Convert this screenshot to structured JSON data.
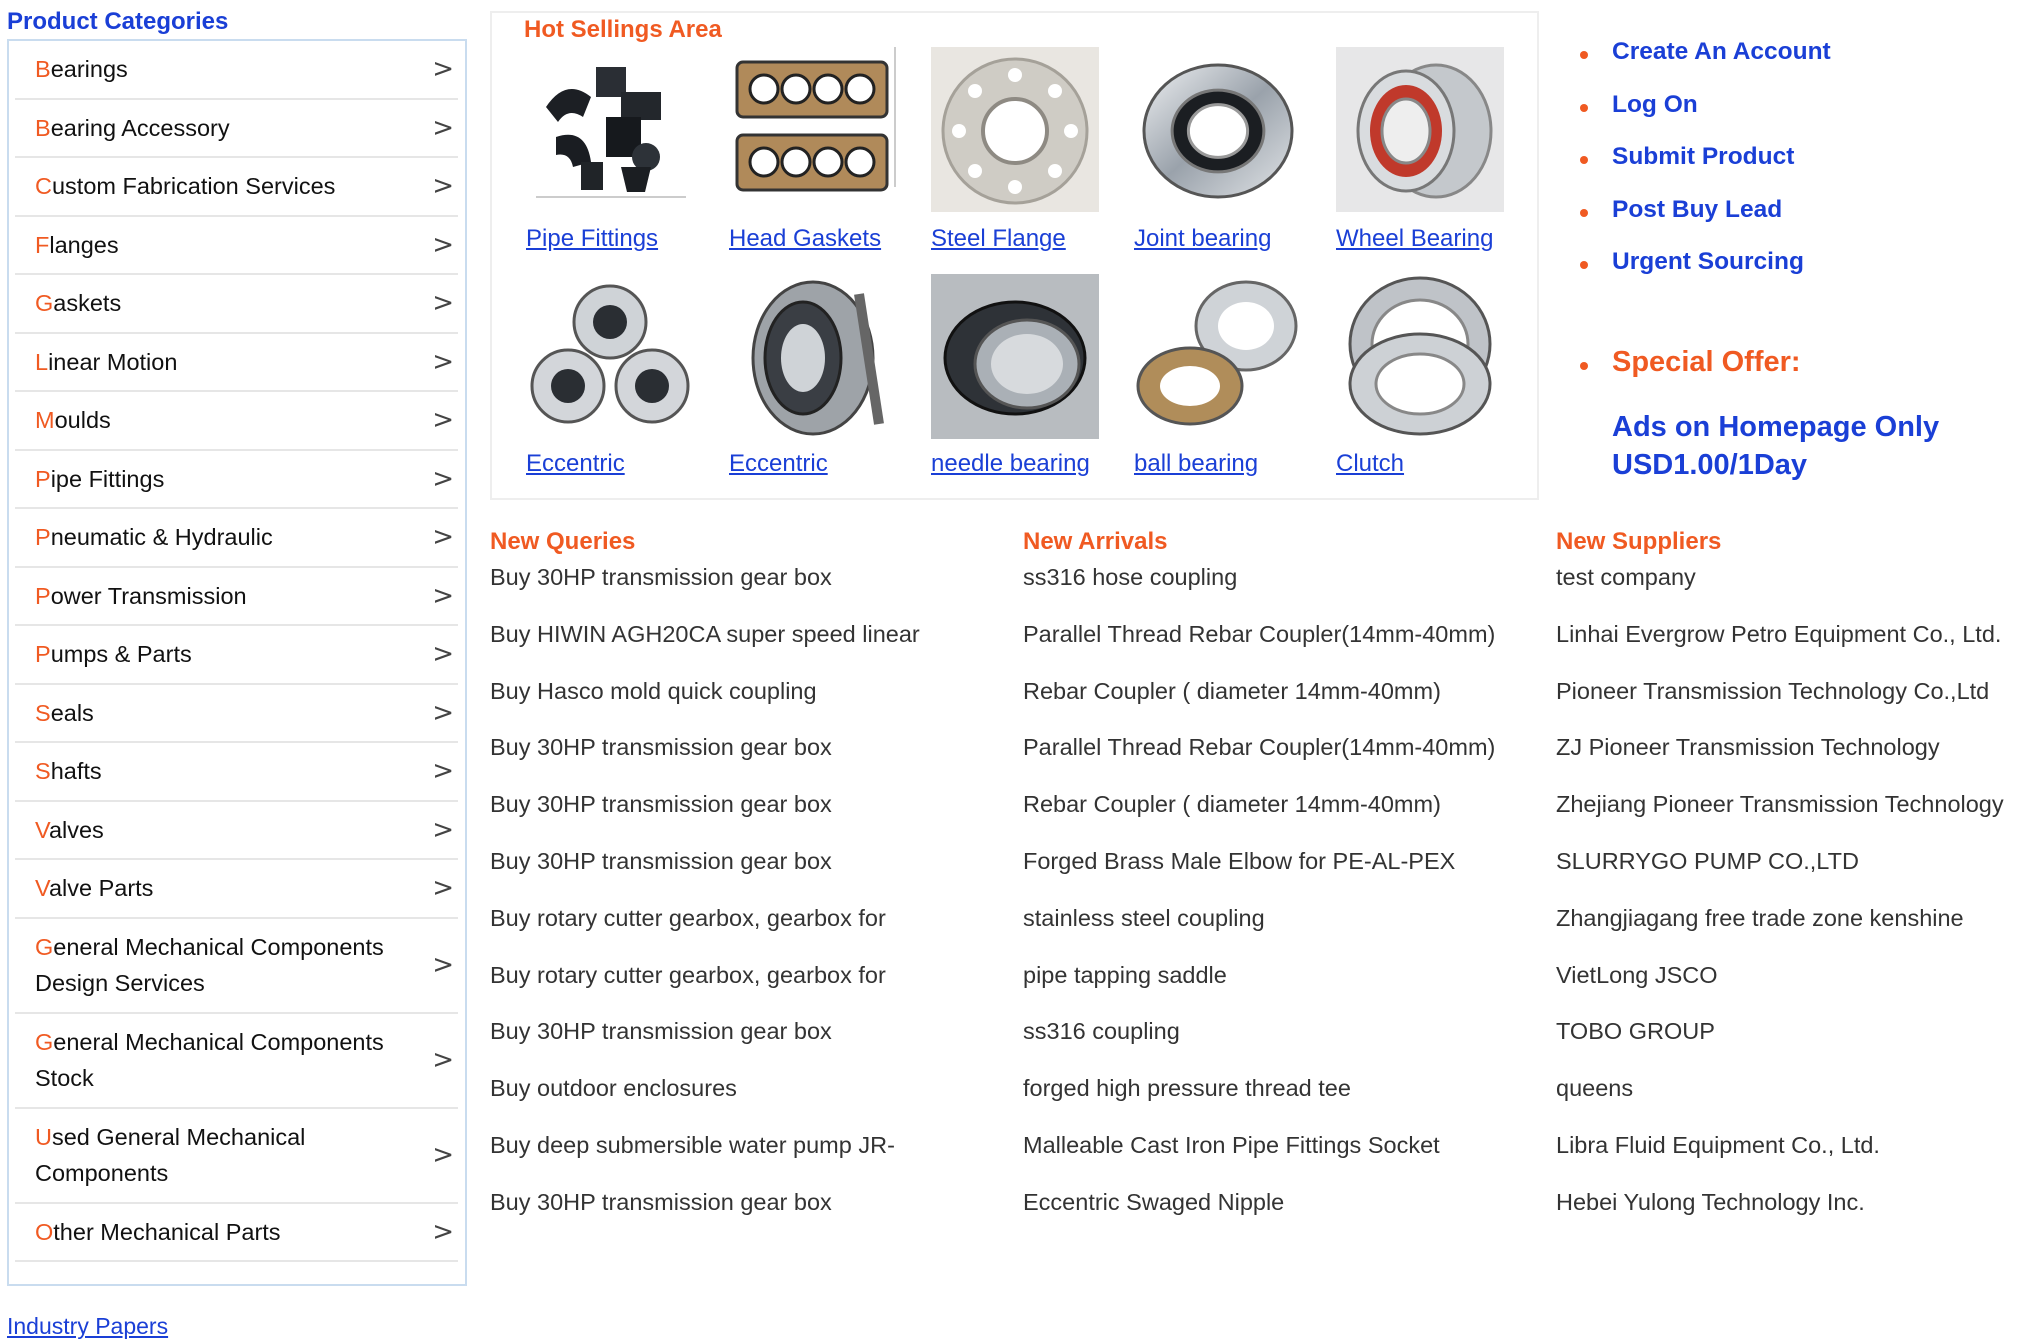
{
  "sidebar": {
    "title": "Product Categories",
    "items": [
      {
        "first": "B",
        "rest": "earings"
      },
      {
        "first": "B",
        "rest": "earing Accessory"
      },
      {
        "first": "C",
        "rest": "ustom Fabrication Services"
      },
      {
        "first": "F",
        "rest": "langes"
      },
      {
        "first": "G",
        "rest": "askets"
      },
      {
        "first": "L",
        "rest": "inear Motion"
      },
      {
        "first": "M",
        "rest": "oulds"
      },
      {
        "first": "P",
        "rest": "ipe Fittings"
      },
      {
        "first": "P",
        "rest": "neumatic & Hydraulic"
      },
      {
        "first": "P",
        "rest": "ower Transmission"
      },
      {
        "first": "P",
        "rest": "umps & Parts"
      },
      {
        "first": "S",
        "rest": "eals"
      },
      {
        "first": "S",
        "rest": "hafts"
      },
      {
        "first": "V",
        "rest": "alves"
      },
      {
        "first": "V",
        "rest": "alve Parts"
      },
      {
        "first": "G",
        "rest": "eneral Mechanical Components Design Services"
      },
      {
        "first": "G",
        "rest": "eneral Mechanical Components Stock"
      },
      {
        "first": "U",
        "rest": "sed General Mechanical Components"
      },
      {
        "first": "O",
        "rest": "ther Mechanical Parts"
      }
    ],
    "arrow": ">",
    "footer_link": "Industry Papers"
  },
  "hot": {
    "title": "Hot Sellings Area",
    "products": [
      {
        "label": "Pipe Fittings",
        "icon": "pipe-fittings-image"
      },
      {
        "label": "Head Gaskets",
        "icon": "head-gaskets-image"
      },
      {
        "label": "Steel Flange",
        "icon": "steel-flange-image"
      },
      {
        "label": "Joint bearing",
        "icon": "joint-bearing-image"
      },
      {
        "label": "Wheel Bearing",
        "icon": "wheel-bearing-image"
      },
      {
        "label": "Eccentric",
        "icon": "eccentric-bearings-image"
      },
      {
        "label": "Eccentric",
        "icon": "tapered-bearing-image"
      },
      {
        "label": "needle bearing",
        "icon": "needle-bearing-image"
      },
      {
        "label": "ball bearing",
        "icon": "thrust-ball-bearing-image"
      },
      {
        "label": "Clutch",
        "icon": "clutch-bearing-image"
      }
    ]
  },
  "account_links": {
    "create": "Create An Account",
    "login": "Log On",
    "submit": "Submit Product",
    "post": "Post Buy Lead",
    "urgent": "Urgent Sourcing",
    "special": "Special Offer:",
    "offer_line1": "Ads on Homepage Only",
    "offer_line2": "USD1.00/1Day"
  },
  "queries": {
    "title": "New Queries",
    "items": [
      "Buy 30HP transmission gear box",
      "Buy HIWIN AGH20CA super speed linear",
      "Buy Hasco mold quick coupling",
      "Buy 30HP transmission gear box",
      "Buy 30HP transmission gear box",
      "Buy 30HP transmission gear box",
      "Buy rotary cutter gearbox, gearbox for",
      "Buy rotary cutter gearbox, gearbox for",
      "Buy 30HP transmission gear box",
      "Buy outdoor enclosures",
      "Buy deep submersible water pump JR-",
      "Buy 30HP transmission gear box"
    ]
  },
  "arrivals": {
    "title": "New Arrivals",
    "items": [
      "ss316 hose coupling",
      "Parallel Thread Rebar Coupler(14mm-40mm)",
      "Rebar Coupler ( diameter 14mm-40mm)",
      "Parallel Thread Rebar Coupler(14mm-40mm)",
      "Rebar Coupler ( diameter 14mm-40mm)",
      "Forged Brass Male Elbow for PE-AL-PEX",
      "stainless steel coupling",
      "pipe tapping saddle",
      "ss316 coupling",
      "forged high pressure thread tee",
      "Malleable Cast Iron Pipe Fittings Socket",
      "Eccentric Swaged Nipple"
    ]
  },
  "suppliers": {
    "title": "New Suppliers",
    "items": [
      "test company",
      "Linhai Evergrow Petro Equipment Co., Ltd.",
      "Pioneer Transmission Technology Co.,Ltd",
      "ZJ Pioneer Transmission Technology",
      "Zhejiang Pioneer Transmission Technology",
      "SLURRYGO PUMP CO.,LTD",
      "Zhangjiagang free trade zone kenshine",
      "VietLong JSCO",
      "TOBO GROUP",
      "queens",
      "Libra Fluid Equipment Co., Ltd.",
      "Hebei Yulong Technology Inc."
    ]
  },
  "colors": {
    "accent": "#f05a22",
    "link": "#1a3fd6",
    "border": "#c9dcef"
  }
}
